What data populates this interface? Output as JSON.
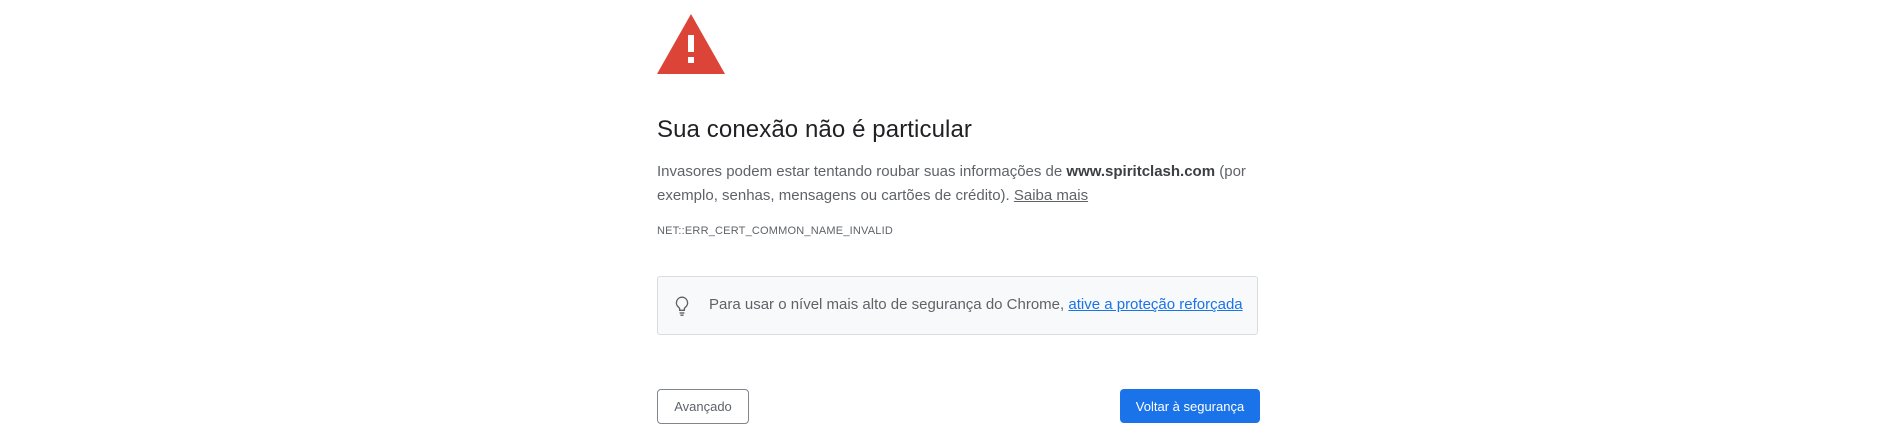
{
  "interstitial": {
    "title": "Sua conexão não é particular",
    "body": {
      "before_domain": "Invasores podem estar tentando roubar suas informações de ",
      "domain": "www.spiritclash.com",
      "after_domain": " (por exemplo, senhas, mensagens ou cartões de crédito). ",
      "learn_more": "Saiba mais"
    },
    "error_code": "NET::ERR_CERT_COMMON_NAME_INVALID",
    "enhanced_protection": {
      "text": "Para usar o nível mais alto de segurança do Chrome, ",
      "link": "ative a proteção reforçada"
    },
    "buttons": {
      "advanced": "Avançado",
      "back_to_safety": "Voltar à segurança"
    }
  },
  "icons": {
    "warning": "warning-triangle-icon",
    "bulb": "lightbulb-icon"
  },
  "colors": {
    "warning_red": "#d94b3f",
    "primary_blue": "#1a73e8",
    "text_secondary": "#5f6368",
    "box_background": "#f8f9fa"
  }
}
